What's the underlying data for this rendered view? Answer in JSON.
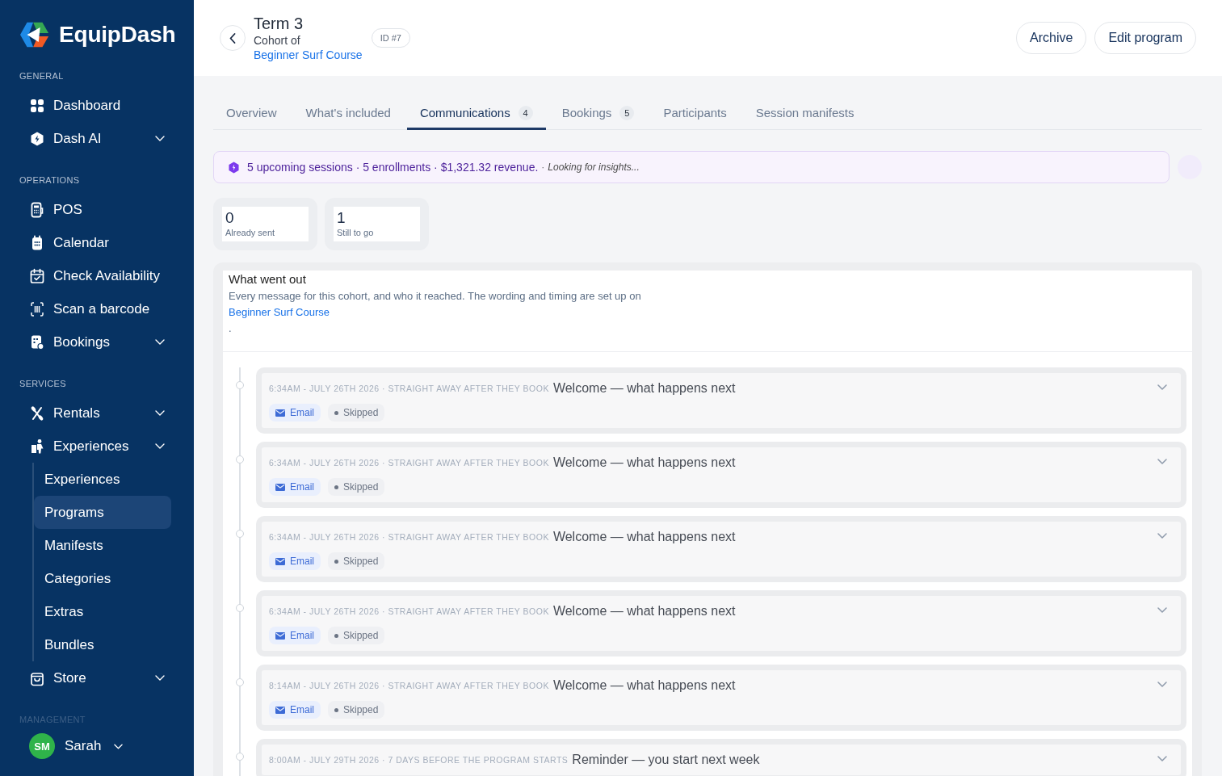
{
  "sidebar": {
    "brand": "EquipDash",
    "sections": [
      {
        "label": "GENERAL",
        "items": [
          {
            "label": "Dashboard",
            "dropdown": false,
            "selected": false
          },
          {
            "label": "Dash AI",
            "dropdown": true,
            "selected": false
          }
        ]
      },
      {
        "label": "OPERATIONS",
        "items": [
          {
            "label": "POS",
            "dropdown": false,
            "selected": false
          },
          {
            "label": "Calendar",
            "dropdown": false,
            "selected": false
          },
          {
            "label": "Check Availability",
            "dropdown": false,
            "selected": false
          },
          {
            "label": "Scan a barcode",
            "dropdown": false,
            "selected": false
          },
          {
            "label": "Bookings",
            "dropdown": true,
            "selected": false
          }
        ]
      },
      {
        "label": "SERVICES",
        "items": [
          {
            "label": "Rentals",
            "dropdown": true,
            "selected": false
          },
          {
            "label": "Experiences",
            "dropdown": true,
            "selected": false,
            "children": [
              {
                "label": "Experiences",
                "selected": false
              },
              {
                "label": "Programs",
                "selected": true
              },
              {
                "label": "Manifests",
                "selected": false
              },
              {
                "label": "Categories",
                "selected": false
              },
              {
                "label": "Extras",
                "selected": false
              },
              {
                "label": "Bundles",
                "selected": false
              }
            ]
          },
          {
            "label": "Store",
            "dropdown": true,
            "selected": false
          }
        ]
      },
      {
        "label": "MANAGEMENT"
      }
    ],
    "user": {
      "initials": "SM",
      "name": "Sarah"
    }
  },
  "header": {
    "title": "Term 3",
    "subtitle": "Cohort of",
    "parent_link": "Beginner Surf Course",
    "id_badge": "ID #7",
    "actions": [
      {
        "label": "Archive"
      },
      {
        "label": "Edit program"
      }
    ]
  },
  "tabs": [
    {
      "label": "Overview",
      "selected": false
    },
    {
      "label": "What's included",
      "selected": false
    },
    {
      "label": "Communications",
      "count": "4",
      "selected": true
    },
    {
      "label": "Bookings",
      "count": "5",
      "selected": false
    },
    {
      "label": "Participants",
      "selected": false
    },
    {
      "label": "Session manifests",
      "selected": false
    }
  ],
  "insights": {
    "summary": "5 upcoming sessions · 5 enrollments · $1,321.32 revenue.",
    "separator": "·",
    "status": "Looking for insights..."
  },
  "stats": [
    {
      "value": "0",
      "label": "Already sent"
    },
    {
      "value": "1",
      "label": "Still to go"
    }
  ],
  "communications": {
    "title": "What went out",
    "description": "Every message for this cohort, and who it reached. The wording and timing are set up on",
    "link": "Beginner Surf Course",
    "trailing": ".",
    "messages": [
      {
        "schedule": "6:34AM - JULY 26TH 2026 · STRAIGHT AWAY AFTER THEY BOOK",
        "title": "Welcome — what happens next",
        "channel": "Email",
        "status": "Skipped",
        "expanded": false
      },
      {
        "schedule": "6:34AM - JULY 26TH 2026 · STRAIGHT AWAY AFTER THEY BOOK",
        "title": "Welcome — what happens next",
        "channel": "Email",
        "status": "Skipped",
        "expanded": false
      },
      {
        "schedule": "6:34AM - JULY 26TH 2026 · STRAIGHT AWAY AFTER THEY BOOK",
        "title": "Welcome — what happens next",
        "channel": "Email",
        "status": "Skipped",
        "expanded": false
      },
      {
        "schedule": "6:34AM - JULY 26TH 2026 · STRAIGHT AWAY AFTER THEY BOOK",
        "title": "Welcome — what happens next",
        "channel": "Email",
        "status": "Skipped",
        "expanded": false
      },
      {
        "schedule": "8:14AM - JULY 26TH 2026 · STRAIGHT AWAY AFTER THEY BOOK",
        "title": "Welcome — what happens next",
        "channel": "Email",
        "status": "Skipped",
        "expanded": false
      },
      {
        "schedule": "8:00AM - JULY 29TH 2026 · 7 DAYS BEFORE THE PROGRAM STARTS",
        "title": "Reminder — you start next week",
        "expanded": false
      }
    ]
  }
}
